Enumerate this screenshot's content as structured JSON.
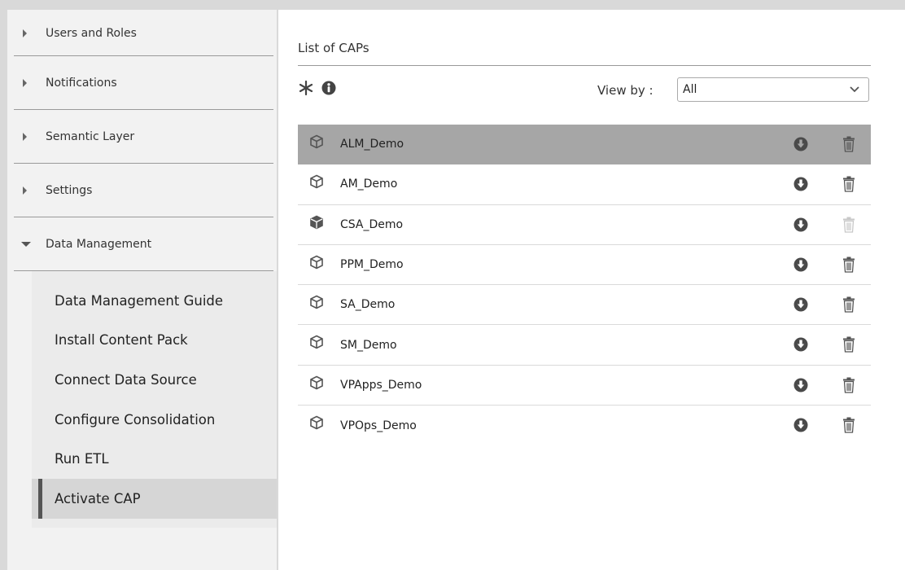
{
  "sidebar": {
    "sections": [
      {
        "label": "Users and Roles",
        "expanded": false
      },
      {
        "label": "Notifications",
        "expanded": false
      },
      {
        "label": "Semantic Layer",
        "expanded": false
      },
      {
        "label": "Settings",
        "expanded": false
      },
      {
        "label": "Data Management",
        "expanded": true
      }
    ],
    "data_management_items": [
      {
        "label": "Data Management Guide"
      },
      {
        "label": "Install Content Pack"
      },
      {
        "label": "Connect Data Source"
      },
      {
        "label": "Configure Consolidation"
      },
      {
        "label": "Run ETL"
      },
      {
        "label": "Activate CAP",
        "active": true
      }
    ]
  },
  "main": {
    "title": "List of CAPs",
    "toolbar": {
      "refresh_icon": "asterisk-icon",
      "info_icon": "info-icon"
    },
    "view_by": {
      "label": "View by :",
      "selected": "All"
    },
    "caps": [
      {
        "name": "ALM_Demo",
        "selected": true,
        "delete_enabled": true
      },
      {
        "name": "AM_Demo",
        "selected": false,
        "delete_enabled": true
      },
      {
        "name": "CSA_Demo",
        "selected": false,
        "delete_enabled": false
      },
      {
        "name": "PPM_Demo",
        "selected": false,
        "delete_enabled": true
      },
      {
        "name": "SA_Demo",
        "selected": false,
        "delete_enabled": true
      },
      {
        "name": "SM_Demo",
        "selected": false,
        "delete_enabled": true
      },
      {
        "name": "VPApps_Demo",
        "selected": false,
        "delete_enabled": true
      },
      {
        "name": "VPOps_Demo",
        "selected": false,
        "delete_enabled": true
      }
    ]
  },
  "colors": {
    "selected_row": "#a6a6a6",
    "active_nav": "#d6d6d6",
    "icon": "#444444",
    "disabled_icon": "#c8c8c8"
  }
}
